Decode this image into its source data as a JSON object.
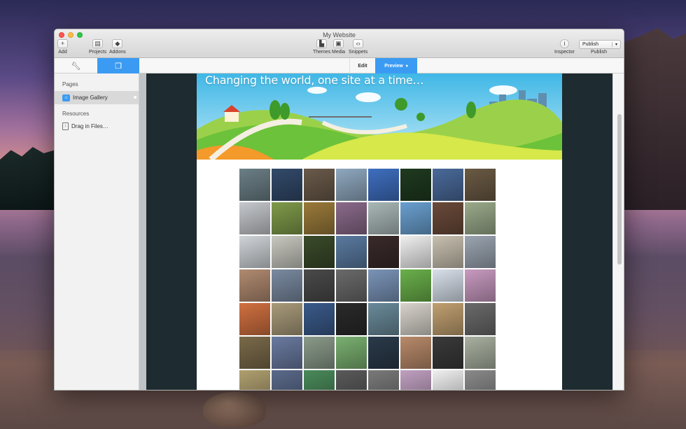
{
  "window": {
    "title": "My Website"
  },
  "toolbar": {
    "add_label": "Add",
    "projects_label": "Projects",
    "addons_label": "Addons",
    "themes_label": "Themes",
    "media_label": "Media",
    "snippets_label": "Snippets",
    "inspector_label": "Inspector",
    "publish_button_label": "Publish",
    "publish_label": "Publish"
  },
  "mode": {
    "edit_label": "Edit",
    "preview_label": "Preview"
  },
  "sidebar": {
    "pages_title": "Pages",
    "pages": [
      {
        "label": "Image Gallery"
      }
    ],
    "resources_title": "Resources",
    "resources": [
      {
        "label": "Drag in Files…"
      }
    ]
  },
  "site": {
    "banner_title": "Changing the world, one site at a time…",
    "gallery_colors": [
      "#6b7f86",
      "#324a6a",
      "#6a5a4a",
      "#8fa8bf",
      "#3f6fc0",
      "#1f3a1f",
      "#4a6a9a",
      "#6a5a44",
      "#c5c8cc",
      "#7f9a4a",
      "#9a7a3a",
      "#8a6a8a",
      "#aab8b8",
      "#6aa0d0",
      "#6a4a3a",
      "#9aaa8a",
      "#d0d4d8",
      "#c8c8c0",
      "#3a4a2a",
      "#5a7aa0",
      "#3a2a2a",
      "#f0f0f0",
      "#c8c0b0",
      "#9aa4b0",
      "#b08a70",
      "#7a8aa0",
      "#4a4a4a",
      "#6a6a6a",
      "#7a94b8",
      "#6ab04a",
      "#d8e0ea",
      "#c89ac0",
      "#d07040",
      "#a89a7a",
      "#3a5a8a",
      "#2a2a2a",
      "#6a8a9a",
      "#d8d4cc",
      "#c0a070",
      "#6a6a6a",
      "#7a6a4a",
      "#6a7aa0",
      "#8a9a8a",
      "#7ab070",
      "#2a3a4a",
      "#b88a6a",
      "#3a3a3a",
      "#a8b0a0",
      "#b0a070",
      "#5a6a8a",
      "#4a8a5a",
      "#5a5a5a",
      "#7a7a7a",
      "#c0a0c0",
      "#f0f0f0",
      "#8a8a8a"
    ]
  }
}
